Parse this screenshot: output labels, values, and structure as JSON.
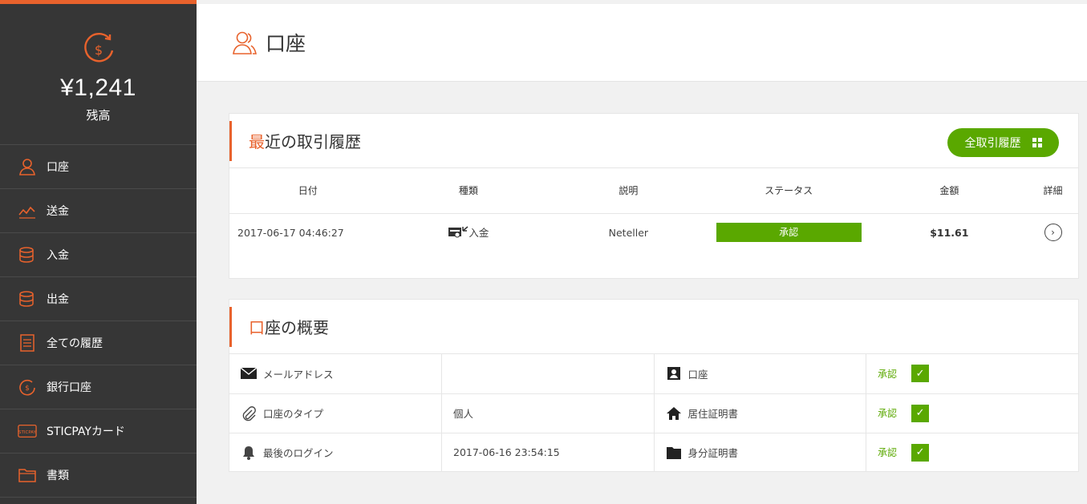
{
  "sidebar": {
    "balance": {
      "amount": "¥1,241",
      "label": "残高"
    },
    "items": [
      {
        "label": "口座",
        "icon": "account-icon"
      },
      {
        "label": "送金",
        "icon": "transfer-icon"
      },
      {
        "label": "入金",
        "icon": "deposit-icon"
      },
      {
        "label": "出金",
        "icon": "withdraw-icon"
      },
      {
        "label": "全ての履歴",
        "icon": "history-icon"
      },
      {
        "label": "銀行口座",
        "icon": "bank-icon"
      },
      {
        "label": "STICPAYカード",
        "icon": "card-icon"
      },
      {
        "label": "書類",
        "icon": "folder-icon"
      }
    ]
  },
  "header": {
    "title": "口座"
  },
  "recent": {
    "title_first": "最",
    "title_rest": "近の取引履歴",
    "all_button": "全取引履歴",
    "columns": [
      "日付",
      "種類",
      "説明",
      "ステータス",
      "金額",
      "詳細"
    ],
    "rows": [
      {
        "date": "2017-06-17 04:46:27",
        "type": "入金",
        "desc": "Neteller",
        "status": "承認",
        "amount": "$11.61"
      }
    ]
  },
  "overview": {
    "title_first": "口",
    "title_rest": "座の概要",
    "rows": [
      {
        "label": "メールアドレス",
        "value": "",
        "doc": "口座",
        "status": "承認"
      },
      {
        "label": "口座のタイプ",
        "value": "個人",
        "doc": "居住証明書",
        "status": "承認"
      },
      {
        "label": "最後のログイン",
        "value": "2017-06-16 23:54:15",
        "doc": "身分証明書",
        "status": "承認"
      }
    ]
  },
  "colors": {
    "accent": "#e8622c",
    "green": "#5aa800",
    "sidebar": "#363636"
  }
}
